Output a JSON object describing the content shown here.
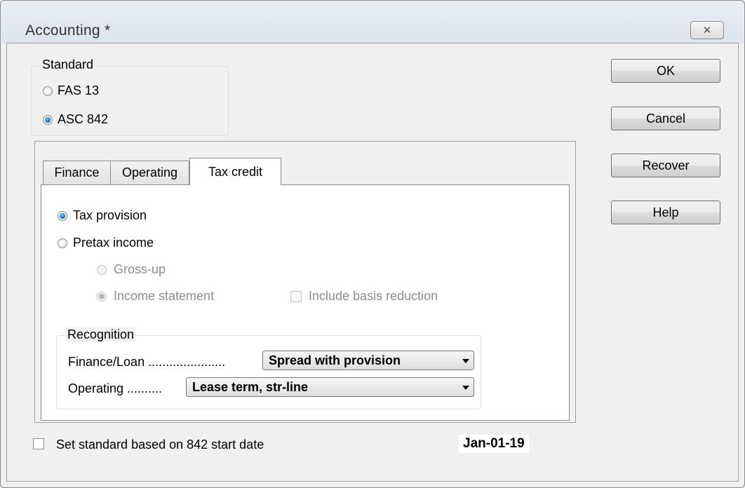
{
  "window": {
    "title": "Accounting *",
    "close_glyph": "✕"
  },
  "standard_group": {
    "legend": "Standard",
    "options": [
      {
        "label": "FAS 13",
        "selected": false
      },
      {
        "label": "ASC 842",
        "selected": true
      }
    ]
  },
  "buttons": {
    "ok": "OK",
    "cancel": "Cancel",
    "recover": "Recover",
    "help": "Help"
  },
  "tabs": [
    {
      "label": "Finance",
      "active": false
    },
    {
      "label": "Operating",
      "active": false
    },
    {
      "label": "Tax credit",
      "active": true
    }
  ],
  "tax_credit": {
    "tax_provision": {
      "label": "Tax provision",
      "selected": true
    },
    "pretax_income": {
      "label": "Pretax income",
      "selected": false
    },
    "gross_up": {
      "label": "Gross-up",
      "selected": false,
      "enabled": false
    },
    "income_statement": {
      "label": "Income statement",
      "selected": true,
      "enabled": false
    },
    "include_basis_reduction": {
      "label": "Include basis reduction",
      "checked": false,
      "enabled": false
    }
  },
  "recognition": {
    "legend": "Recognition",
    "finance_loan": {
      "label": "Finance/Loan ......................",
      "value": "Spread with provision"
    },
    "operating": {
      "label": "Operating ..........",
      "value": "Lease term, str-line"
    }
  },
  "footer": {
    "checkbox_label": "Set standard based on 842 start date",
    "checked": false,
    "date": "Jan-01-19"
  },
  "colors": {
    "background": "#f0f0f0",
    "radio_selected": "#1f6fc2"
  }
}
